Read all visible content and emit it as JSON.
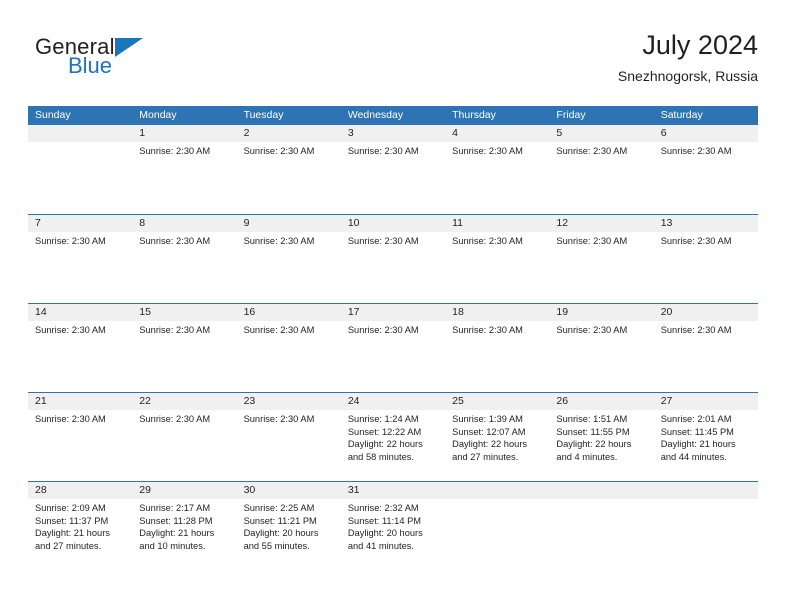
{
  "brand": {
    "logo_text_top": "General",
    "logo_text_bottom": "Blue",
    "logo_icon": "triangle-flag-icon",
    "accent_color": "#1a75bb"
  },
  "header": {
    "title": "July 2024",
    "subtitle": "Snezhnogorsk, Russia"
  },
  "colors": {
    "header_blue": "#2e74b5",
    "row_separator_blue": "#2e74b5",
    "day_band_gray": "#f0f0f0",
    "text": "#231f20"
  },
  "calendar": {
    "weekday_headers": [
      "Sunday",
      "Monday",
      "Tuesday",
      "Wednesday",
      "Thursday",
      "Friday",
      "Saturday"
    ],
    "weeks": [
      [
        {
          "day": "",
          "lines": []
        },
        {
          "day": "1",
          "lines": [
            "Sunrise: 2:30 AM"
          ]
        },
        {
          "day": "2",
          "lines": [
            "Sunrise: 2:30 AM"
          ]
        },
        {
          "day": "3",
          "lines": [
            "Sunrise: 2:30 AM"
          ]
        },
        {
          "day": "4",
          "lines": [
            "Sunrise: 2:30 AM"
          ]
        },
        {
          "day": "5",
          "lines": [
            "Sunrise: 2:30 AM"
          ]
        },
        {
          "day": "6",
          "lines": [
            "Sunrise: 2:30 AM"
          ]
        }
      ],
      [
        {
          "day": "7",
          "lines": [
            "Sunrise: 2:30 AM"
          ]
        },
        {
          "day": "8",
          "lines": [
            "Sunrise: 2:30 AM"
          ]
        },
        {
          "day": "9",
          "lines": [
            "Sunrise: 2:30 AM"
          ]
        },
        {
          "day": "10",
          "lines": [
            "Sunrise: 2:30 AM"
          ]
        },
        {
          "day": "11",
          "lines": [
            "Sunrise: 2:30 AM"
          ]
        },
        {
          "day": "12",
          "lines": [
            "Sunrise: 2:30 AM"
          ]
        },
        {
          "day": "13",
          "lines": [
            "Sunrise: 2:30 AM"
          ]
        }
      ],
      [
        {
          "day": "14",
          "lines": [
            "Sunrise: 2:30 AM"
          ]
        },
        {
          "day": "15",
          "lines": [
            "Sunrise: 2:30 AM"
          ]
        },
        {
          "day": "16",
          "lines": [
            "Sunrise: 2:30 AM"
          ]
        },
        {
          "day": "17",
          "lines": [
            "Sunrise: 2:30 AM"
          ]
        },
        {
          "day": "18",
          "lines": [
            "Sunrise: 2:30 AM"
          ]
        },
        {
          "day": "19",
          "lines": [
            "Sunrise: 2:30 AM"
          ]
        },
        {
          "day": "20",
          "lines": [
            "Sunrise: 2:30 AM"
          ]
        }
      ],
      [
        {
          "day": "21",
          "lines": [
            "Sunrise: 2:30 AM"
          ]
        },
        {
          "day": "22",
          "lines": [
            "Sunrise: 2:30 AM"
          ]
        },
        {
          "day": "23",
          "lines": [
            "Sunrise: 2:30 AM"
          ]
        },
        {
          "day": "24",
          "lines": [
            "Sunrise: 1:24 AM",
            "Sunset: 12:22 AM",
            "Daylight: 22 hours and 58 minutes."
          ]
        },
        {
          "day": "25",
          "lines": [
            "Sunrise: 1:39 AM",
            "Sunset: 12:07 AM",
            "Daylight: 22 hours and 27 minutes."
          ]
        },
        {
          "day": "26",
          "lines": [
            "Sunrise: 1:51 AM",
            "Sunset: 11:55 PM",
            "Daylight: 22 hours and 4 minutes."
          ]
        },
        {
          "day": "27",
          "lines": [
            "Sunrise: 2:01 AM",
            "Sunset: 11:45 PM",
            "Daylight: 21 hours and 44 minutes."
          ]
        }
      ],
      [
        {
          "day": "28",
          "lines": [
            "Sunrise: 2:09 AM",
            "Sunset: 11:37 PM",
            "Daylight: 21 hours and 27 minutes."
          ]
        },
        {
          "day": "29",
          "lines": [
            "Sunrise: 2:17 AM",
            "Sunset: 11:28 PM",
            "Daylight: 21 hours and 10 minutes."
          ]
        },
        {
          "day": "30",
          "lines": [
            "Sunrise: 2:25 AM",
            "Sunset: 11:21 PM",
            "Daylight: 20 hours and 55 minutes."
          ]
        },
        {
          "day": "31",
          "lines": [
            "Sunrise: 2:32 AM",
            "Sunset: 11:14 PM",
            "Daylight: 20 hours and 41 minutes."
          ]
        },
        {
          "day": "",
          "lines": []
        },
        {
          "day": "",
          "lines": []
        },
        {
          "day": "",
          "lines": []
        }
      ]
    ]
  }
}
